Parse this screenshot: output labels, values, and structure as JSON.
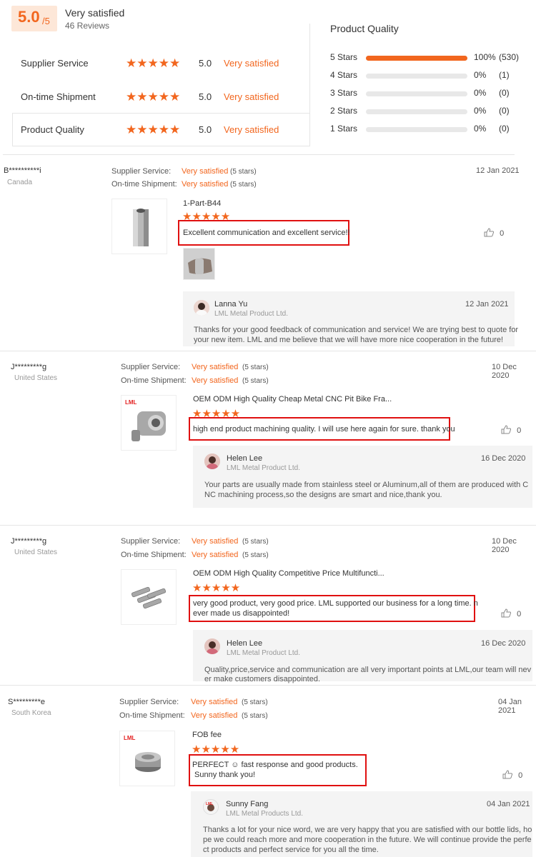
{
  "summary": {
    "score": "5.0",
    "score_of": "/5",
    "label": "Very satisfied",
    "reviews": "46 Reviews",
    "rows": [
      {
        "label": "Supplier Service",
        "stars": "★★★★★",
        "score": "5.0",
        "text": "Very satisfied"
      },
      {
        "label": "On-time Shipment",
        "stars": "★★★★★",
        "score": "5.0",
        "text": "Very satisfied"
      },
      {
        "label": "Product Quality",
        "stars": "★★★★★",
        "score": "5.0",
        "text": "Very satisfied"
      }
    ]
  },
  "quality": {
    "title": "Product Quality",
    "bars": [
      {
        "label": "5  Stars",
        "percent": 100,
        "pct": "100%",
        "count": "(530)"
      },
      {
        "label": "4  Stars",
        "percent": 0,
        "pct": "0%",
        "count": "(1)"
      },
      {
        "label": "3  Stars",
        "percent": 0,
        "pct": "0%",
        "count": "(0)"
      },
      {
        "label": "2  Stars",
        "percent": 0,
        "pct": "0%",
        "count": "(0)"
      },
      {
        "label": "1  Stars",
        "percent": 0,
        "pct": "0%",
        "count": "(0)"
      }
    ]
  },
  "labels": {
    "supplier_service": "Supplier Service:",
    "ontime_shipment": "On-time Shipment:",
    "very_satisfied": "Very satisfied",
    "five_stars": "(5 stars)",
    "stars": "★★★★★",
    "like_icon": "thumbs-up-icon"
  },
  "reviews": [
    {
      "name": "B**********i",
      "country": "Canada",
      "date": "12 Jan 2021",
      "product": "1-Part-B44",
      "comment_1": "Excellent communication and excellent service!!",
      "comment_2": "",
      "likes": "0",
      "reply": {
        "name": "Lanna Yu",
        "company": "LML Metal Product Ltd.",
        "date": "12 Jan 2021",
        "text_1": "Thanks for your good feedback of communication and service! We are trying best to quote for",
        "text_2": "your new item. LML and me believe that we will have more nice cooperation in the future!"
      }
    },
    {
      "name": "J*********g",
      "country": "United States",
      "date": "10 Dec 2020",
      "logo": "LML",
      "product": "OEM ODM High Quality Cheap Metal CNC Pit Bike Fra...",
      "comment_1": "high end product machining quality. I will use here again for sure. thank you",
      "comment_2": "",
      "likes": "0",
      "reply": {
        "name": "Helen Lee",
        "company": "LML Metal Product Ltd.",
        "date": "16 Dec 2020",
        "text_1": "Your parts are usually made from stainless steel or Aluminum,all of them are produced with C",
        "text_2": "NC machining process,so the designs are smart and nice,thank you."
      }
    },
    {
      "name": "J*********g",
      "country": "United States",
      "date": "10 Dec 2020",
      "product": "OEM ODM High Quality Competitive Price Multifuncti...",
      "comment_1": "very good product, very good price. LML supported our business for a long time. n",
      "comment_2": "ever made us disappointed!",
      "likes": "0",
      "reply": {
        "name": "Helen Lee",
        "company": "LML Metal Product Ltd.",
        "date": "16 Dec 2020",
        "text_1": "Quality,price,service and communication are all very important points at LML,our team will nev",
        "text_2": "er make customers disappointed."
      }
    },
    {
      "name": "S*********e",
      "country": "South Korea",
      "date": "04 Jan 2021",
      "logo": "LML",
      "product": "FOB fee",
      "comment_1": "PERFECT ☺ fast response and good products.",
      "comment_2": "Sunny thank you!",
      "likes": "0",
      "reply": {
        "name": "Sunny Fang",
        "company": "LML Metal Products Ltd.",
        "date": "04 Jan 2021",
        "text_1": "Thanks a lot for your nice word, we are very happy that you are satisfied with our bottle lids, ho",
        "text_2": "pe we could reach more and more cooperation in the future. We will continue provide the perfe",
        "text_3": "ct products and perfect service for you all the time."
      }
    }
  ]
}
